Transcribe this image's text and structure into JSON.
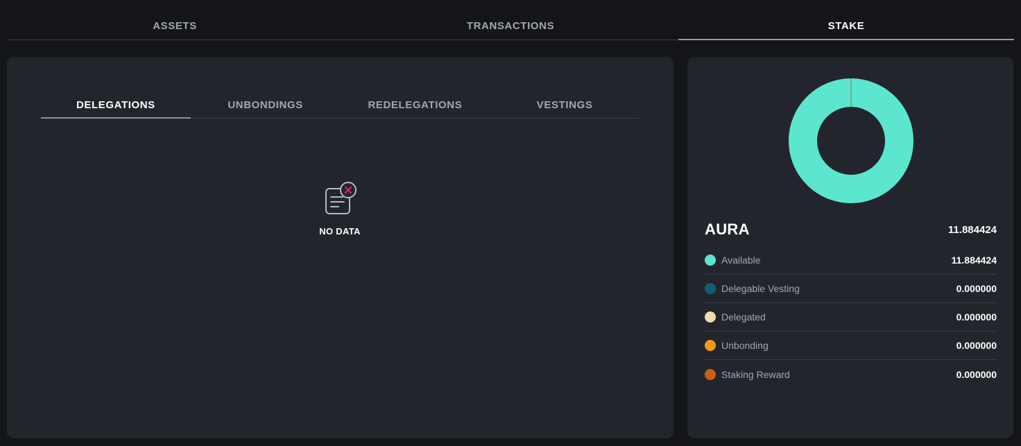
{
  "top_tabs": [
    {
      "label": "ASSETS"
    },
    {
      "label": "TRANSACTIONS"
    },
    {
      "label": "STAKE"
    }
  ],
  "sub_tabs": [
    {
      "label": "DELEGATIONS"
    },
    {
      "label": "UNBONDINGS"
    },
    {
      "label": "REDELEGATIONS"
    },
    {
      "label": "VESTINGS"
    }
  ],
  "empty_state": {
    "label": "NO DATA",
    "icon": "no-data-document-icon"
  },
  "balance": {
    "token": "AURA",
    "total": "11.884424",
    "items": [
      {
        "label": "Available",
        "value": "11.884424",
        "color": "#5ce6d0"
      },
      {
        "label": "Delegable Vesting",
        "value": "0.000000",
        "color": "#0e5f73"
      },
      {
        "label": "Delegated",
        "value": "0.000000",
        "color": "#eedcb0"
      },
      {
        "label": "Unbonding",
        "value": "0.000000",
        "color": "#f09b16"
      },
      {
        "label": "Staking Reward",
        "value": "0.000000",
        "color": "#c8620f"
      }
    ]
  },
  "colors": {
    "background": "#141519",
    "panel": "#23252c",
    "donut_main": "#5ce6d0",
    "empty_icon_accent": "#e0245e"
  }
}
